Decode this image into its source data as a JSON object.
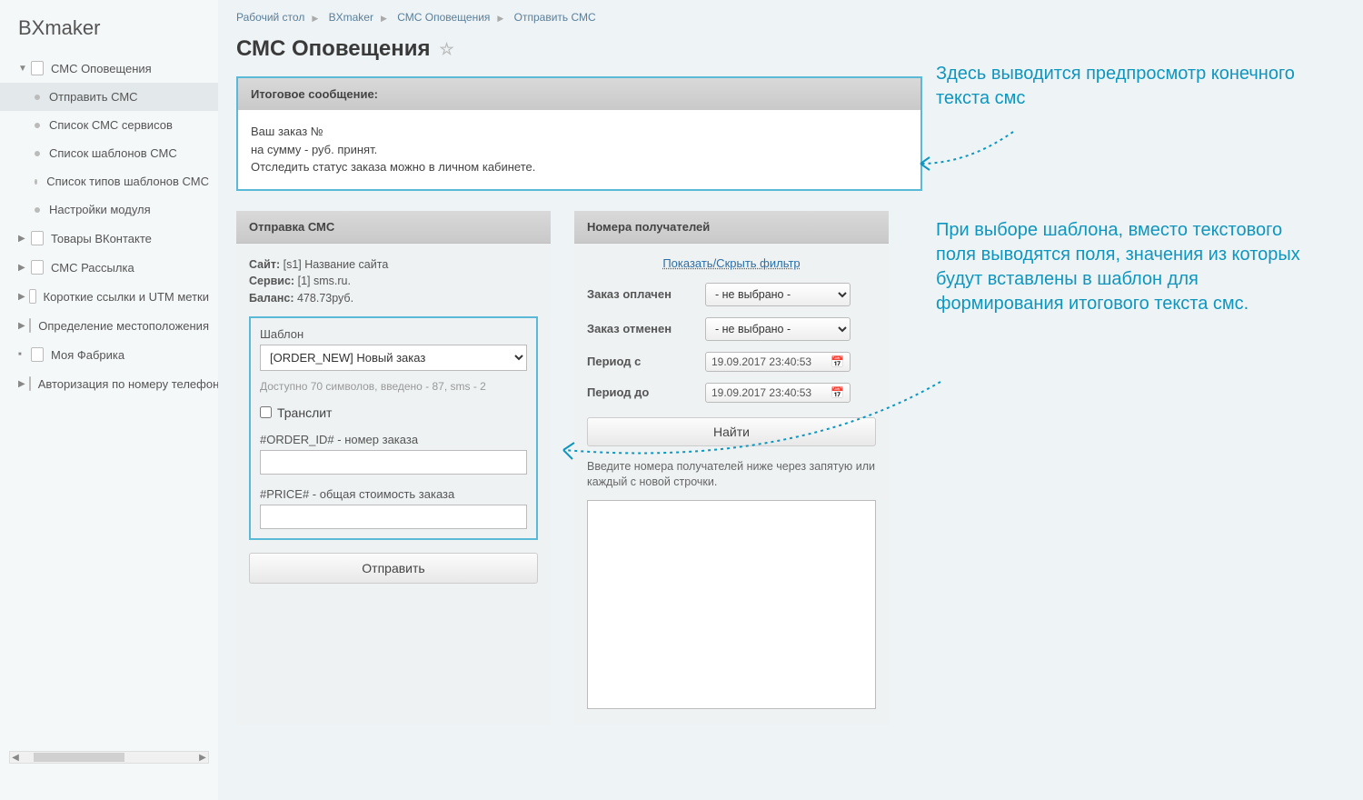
{
  "brand": "BXmaker",
  "sidebar": {
    "items": [
      {
        "label": "СМС Оповещения",
        "expanded": true,
        "children": [
          {
            "label": "Отправить СМС",
            "active": true
          },
          {
            "label": "Список СМС сервисов"
          },
          {
            "label": "Список шаблонов СМС"
          },
          {
            "label": "Список типов шаблонов СМС"
          },
          {
            "label": "Настройки модуля"
          }
        ]
      },
      {
        "label": "Товары ВКонтакте"
      },
      {
        "label": "СМС Рассылка"
      },
      {
        "label": "Короткие ссылки и UTM метки"
      },
      {
        "label": "Определение местоположения"
      },
      {
        "label": "Моя Фабрика",
        "leaf": true
      },
      {
        "label": "Авторизация по номеру телефона"
      }
    ]
  },
  "breadcrumbs": [
    "Рабочий стол",
    "BXmaker",
    "СМС Оповещения",
    "Отправить СМС"
  ],
  "page_title": "СМС Оповещения",
  "preview": {
    "title": "Итоговое сообщение:",
    "body": "Ваш заказ №\nна сумму - руб. принят.\nОтследить статус заказа можно в личном кабинете."
  },
  "send_panel": {
    "title": "Отправка СМС",
    "site_label": "Сайт:",
    "site_value": "[s1] Название сайта",
    "service_label": "Сервис:",
    "service_value": "[1] sms.ru.",
    "balance_label": "Баланс:",
    "balance_value": "478.73руб.",
    "template_label": "Шаблон",
    "template_selected": "[ORDER_NEW] Новый заказ",
    "chars_hint": "Доступно 70 символов, введено - 87, sms - 2",
    "translit_label": "Транслит",
    "field1_label": "#ORDER_ID# - номер заказа",
    "field1_value": "",
    "field2_label": "#PRICE# - общая стоимость заказа",
    "field2_value": "",
    "send_button": "Отправить"
  },
  "recipients_panel": {
    "title": "Номера получателей",
    "filter_toggle": "Показать/Скрыть фильтр",
    "rows": {
      "paid": {
        "label": "Заказ оплачен",
        "value": "- не выбрано -"
      },
      "cancelled": {
        "label": "Заказ отменен",
        "value": "- не выбрано -"
      },
      "from": {
        "label": "Период с",
        "value": "19.09.2017 23:40:53"
      },
      "to": {
        "label": "Период до",
        "value": "19.09.2017 23:40:53"
      }
    },
    "find_button": "Найти",
    "hint": "Введите номера получателей ниже через запятую или каждый с новой строчки.",
    "textarea_value": ""
  },
  "annotations": {
    "a1": "Здесь выводится предпросмотр конечного текста смс",
    "a2": "При выборе шаблона, вместо текстового поля выводятся поля, значения из которых будут вставлены в шаблон для формирования итогового текста смс."
  }
}
